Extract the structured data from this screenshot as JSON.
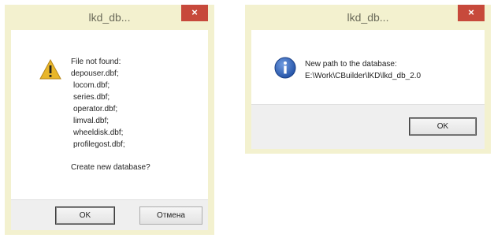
{
  "dialog1": {
    "title": "lkd_db...",
    "close_glyph": "×",
    "icon": "warning-icon",
    "message_lines": [
      "File not found:",
      "depouser.dbf;",
      "locom.dbf;",
      "series.dbf;",
      "operator.dbf;",
      "limval.dbf;",
      "wheeldisk.dbf;",
      "profilegost.dbf;"
    ],
    "question": "Create new database?",
    "ok_label": "OK",
    "cancel_label": "Отмена"
  },
  "dialog2": {
    "title": "lkd_db...",
    "close_glyph": "×",
    "icon": "info-icon",
    "message_lines": [
      "New path to the database:",
      "E:\\Work\\CBuilder\\lKD\\lkd_db_2.0"
    ],
    "ok_label": "OK"
  },
  "colors": {
    "titlebar": "#f3f1cf",
    "close_button": "#c7493b",
    "warning_yellow": "#e8b62a",
    "info_blue": "#2a5db0"
  }
}
